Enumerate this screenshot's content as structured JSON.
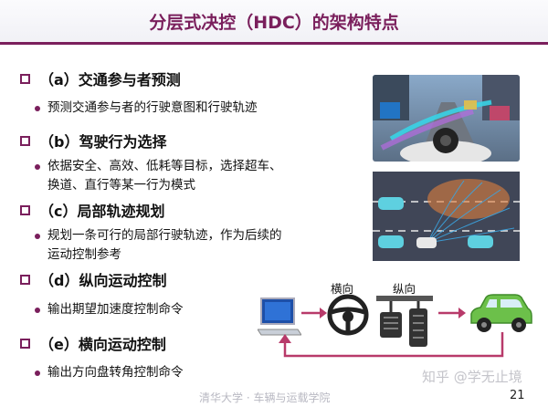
{
  "slide": {
    "title": "分层式决控（HDC）的架构特点",
    "sections": [
      {
        "label": "（a）交通参与者预测",
        "bullets": [
          "预测交通参与者的行驶意图和行驶轨迹"
        ]
      },
      {
        "label": "（b）驾驶行为选择",
        "bullets": [
          "依据安全、高效、低耗等目标，选择超车、",
          "换道、直行等某一行为模式"
        ]
      },
      {
        "label": "（c）局部轨迹规划",
        "bullets": [
          "规划一条可行的局部行驶轨迹，作为后续的",
          "运动控制参考"
        ]
      },
      {
        "label": "（d）纵向运动控制",
        "bullets": [
          "输出期望加速度控制命令"
        ]
      },
      {
        "label": "（e）横向运动控制",
        "bullets": [
          "输出方向盘转角控制命令"
        ]
      }
    ],
    "diagram": {
      "steering_label": "横向",
      "pedal_label": "纵向"
    },
    "footer": "清华大学 · 车辆与运载学院",
    "watermark": "知乎 @学无止境",
    "page_number": "21"
  },
  "colors": {
    "accent": "#7a1f5c",
    "arrow": "#b83a6a",
    "car": "#6cc04a"
  },
  "icons": [
    "square-bullet-icon",
    "round-bullet-icon",
    "computer-icon",
    "steering-wheel-icon",
    "pedals-icon",
    "car-icon",
    "arrow-icon"
  ]
}
